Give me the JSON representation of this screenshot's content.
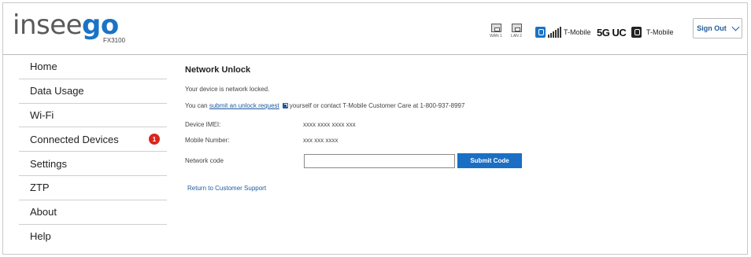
{
  "header": {
    "logo_part1": "insee",
    "logo_part2": "go",
    "model": "FX3100",
    "ports": [
      {
        "label": "WAN 1",
        "icon": "ethernet-port-icon"
      },
      {
        "label": "LAN 2",
        "icon": "ethernet-port-icon"
      }
    ],
    "carrier1": "T-Mobile",
    "network_type": "5G UC",
    "carrier2": "T-Mobile",
    "sign_out_label": "Sign Out"
  },
  "sidebar": {
    "items": [
      {
        "label": "Home"
      },
      {
        "label": "Data Usage"
      },
      {
        "label": "Wi-Fi"
      },
      {
        "label": "Connected Devices",
        "badge": "1"
      },
      {
        "label": "Settings"
      },
      {
        "label": "ZTP"
      },
      {
        "label": "About"
      },
      {
        "label": "Help"
      }
    ]
  },
  "main": {
    "title": "Network Unlock",
    "locked_text": "Your device is network locked.",
    "unlock_prefix": "You can ",
    "unlock_link": "submit an unlock request",
    "unlock_suffix": "yourself or contact T-Mobile Customer Care at 1-800-937-8997",
    "imei_label": "Device IMEI:",
    "imei_value": "xxxx xxxx xxxx xxx",
    "mobile_label": "Mobile Number:",
    "mobile_value": "xxx xxx xxxx",
    "code_label": "Network code",
    "code_value": "",
    "code_placeholder": "",
    "submit_label": "Submit Code",
    "return_link": "Return to Customer Support"
  },
  "colors": {
    "accent": "#1a6fc4",
    "link": "#1f5a9e",
    "badge": "#d9261c"
  }
}
